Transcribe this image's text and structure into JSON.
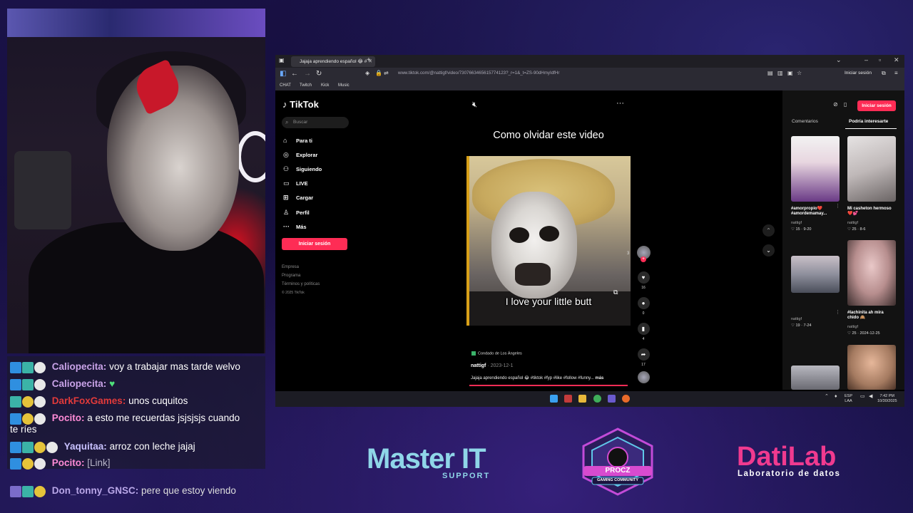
{
  "chat": {
    "messages": [
      {
        "user": "Caliopecita:",
        "text": "voy a trabajar mas tarde welvo"
      },
      {
        "user": "Caliopecita:",
        "text": "♥"
      },
      {
        "user": "DarkFoxGames:",
        "text": "unos cuquitos"
      },
      {
        "user": "Pocito:",
        "text": "a esto me recuerdas jsjsjsjs cuando",
        "text2": "te ríes"
      },
      {
        "user": "Yaquitaa:",
        "text": "arroz con leche jajaj"
      },
      {
        "user": "Pocito:",
        "text": "[Link]"
      },
      {
        "user": "Don_tonny_GNSC:",
        "text": "pere que estoy viendo"
      }
    ]
  },
  "browser": {
    "tab_title": "Jajaja aprendiendo español 😂 #",
    "url": "www.tiktok.com/@nattigf/video/7307663465615774123?_r=1&_t=ZS-90dHmyIdfHr",
    "signin": "Iniciar sesión",
    "bookmarks": [
      "CHAT",
      "Twitch",
      "Kick",
      "Music"
    ]
  },
  "tiktok": {
    "logo": "TikTok",
    "search_placeholder": "Buscar",
    "nav": [
      "Para ti",
      "Explorar",
      "Siguiendo",
      "LIVE",
      "Cargar",
      "Perfil",
      "Más"
    ],
    "login_button": "Iniciar sesión",
    "footer": [
      "Empresa",
      "Programa",
      "Términos y políticas",
      "© 2025 TikTok"
    ],
    "video_title": "Como olvidar este video",
    "title_emoji": "😂",
    "caption": "I love your little butt",
    "reaction_emojis": "😂😂😂😂",
    "location": "Condado de Los Ángeles",
    "author": "nattigf",
    "date": "· 2023-12-1",
    "description": "Jajaja aprendiendo español 😂 #tiktok #fyp #like #follow #funny...",
    "more": "más",
    "counts": {
      "avatar": "3",
      "likes": "16",
      "comments": "0",
      "saves": "4",
      "shares": "17"
    }
  },
  "right_panel": {
    "login_button": "Iniciar sesión",
    "tab_comments": "Comentarios",
    "tab_suggest": "Podría interesarte",
    "items": [
      {
        "label": "#amorpropio❤️ #amordemamay...",
        "user": "nattigf",
        "stats": "♡ 15 · 9-20"
      },
      {
        "label": "Mi casheton hermoso ❤️💕",
        "user": "nattigf",
        "stats": "♡ 25 · 8-6"
      },
      {
        "label": "",
        "user": "nattigf",
        "stats": "♡ 19 · 7-24"
      },
      {
        "label": "#lachinita ah mira chido 🙈",
        "user": "nattigf",
        "stats": "♡ 25 · 2024-12-25"
      }
    ]
  },
  "taskbar": {
    "lang": "ESP",
    "lang2": "LAA",
    "time": "7:42 PM",
    "date": "10/30/2025"
  },
  "logos": {
    "master_it": "Master IT",
    "master_it_sub": "SUPPORT",
    "procz": "PROCZ",
    "procz_sub": "GAMING COMMUNITY",
    "datilab": "DatiLab",
    "datilab_sub": "Laboratorio de datos"
  },
  "colors": {
    "tiktok_red": "#fe2c55",
    "chat_red": "#e23a3a",
    "master_it": "#8fd6e8",
    "datilab": "#f03a8f"
  }
}
